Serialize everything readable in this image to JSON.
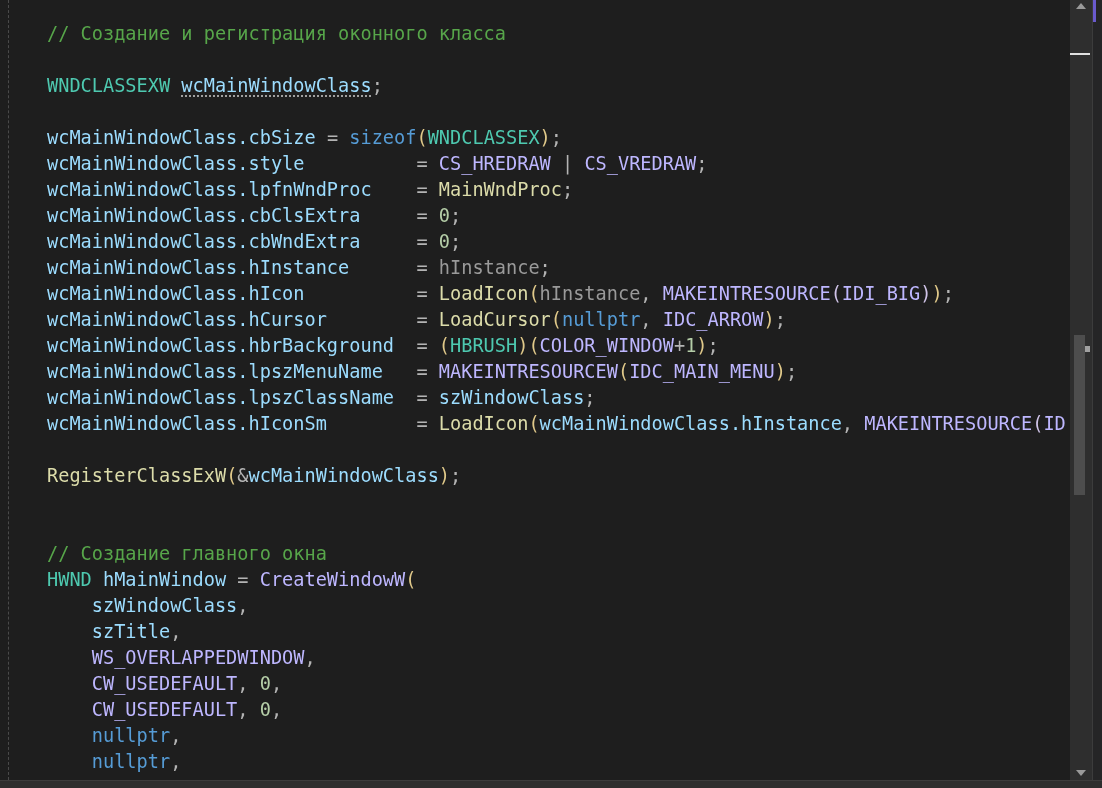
{
  "editor": {
    "lines": [
      {
        "kind": "code",
        "tokens": [
          {
            "kind": "comment",
            "text": "// Создание и регистрация оконного класса"
          }
        ]
      },
      {
        "kind": "blank"
      },
      {
        "kind": "code",
        "tokens": [
          {
            "kind": "type",
            "text": "WNDCLASSEXW"
          },
          {
            "kind": "var",
            "text": "wcMainWindowClass",
            "hinted": true,
            "gap": true
          },
          {
            "kind": "punct",
            "text": ";"
          }
        ]
      },
      {
        "kind": "blank"
      },
      {
        "kind": "code",
        "tokens": [
          {
            "kind": "var",
            "text": "wcMainWindowClass"
          },
          {
            "kind": "member",
            "text": ".cbSize"
          },
          {
            "kind": "punct",
            "text": " = "
          },
          {
            "kind": "keyword",
            "text": "sizeof"
          },
          {
            "kind": "bracket",
            "text": "("
          },
          {
            "kind": "type",
            "text": "WNDCLASSEX"
          },
          {
            "kind": "bracket",
            "text": ")"
          },
          {
            "kind": "punct",
            "text": ";"
          }
        ]
      },
      {
        "kind": "code",
        "tokens": [
          {
            "kind": "var",
            "text": "wcMainWindowClass"
          },
          {
            "kind": "member",
            "text": ".style"
          },
          {
            "kind": "punct",
            "text": "          = "
          },
          {
            "kind": "macro",
            "text": "CS_HREDRAW"
          },
          {
            "kind": "punct",
            "text": " | "
          },
          {
            "kind": "macro",
            "text": "CS_VREDRAW"
          },
          {
            "kind": "punct",
            "text": ";"
          }
        ]
      },
      {
        "kind": "code",
        "tokens": [
          {
            "kind": "var",
            "text": "wcMainWindowClass"
          },
          {
            "kind": "member",
            "text": ".lpfnWndProc"
          },
          {
            "kind": "punct",
            "text": "    = "
          },
          {
            "kind": "function",
            "text": "MainWndProc"
          },
          {
            "kind": "punct",
            "text": ";"
          }
        ]
      },
      {
        "kind": "code",
        "tokens": [
          {
            "kind": "var",
            "text": "wcMainWindowClass"
          },
          {
            "kind": "member",
            "text": ".cbClsExtra"
          },
          {
            "kind": "punct",
            "text": "     = "
          },
          {
            "kind": "number",
            "text": "0"
          },
          {
            "kind": "punct",
            "text": ";"
          }
        ]
      },
      {
        "kind": "code",
        "tokens": [
          {
            "kind": "var",
            "text": "wcMainWindowClass"
          },
          {
            "kind": "member",
            "text": ".cbWndExtra"
          },
          {
            "kind": "punct",
            "text": "     = "
          },
          {
            "kind": "number",
            "text": "0"
          },
          {
            "kind": "punct",
            "text": ";"
          }
        ]
      },
      {
        "kind": "code",
        "tokens": [
          {
            "kind": "var",
            "text": "wcMainWindowClass"
          },
          {
            "kind": "member",
            "text": ".hInstance"
          },
          {
            "kind": "punct",
            "text": "      = "
          },
          {
            "kind": "param",
            "text": "hInstance"
          },
          {
            "kind": "punct",
            "text": ";"
          }
        ]
      },
      {
        "kind": "code",
        "tokens": [
          {
            "kind": "var",
            "text": "wcMainWindowClass"
          },
          {
            "kind": "member",
            "text": ".hIcon"
          },
          {
            "kind": "punct",
            "text": "          = "
          },
          {
            "kind": "function",
            "text": "LoadIcon"
          },
          {
            "kind": "bracket",
            "text": "("
          },
          {
            "kind": "param",
            "text": "hInstance"
          },
          {
            "kind": "punct",
            "text": ", "
          },
          {
            "kind": "macro",
            "text": "MAKEINTRESOURCE"
          },
          {
            "kind": "bracket2",
            "text": "("
          },
          {
            "kind": "macro",
            "text": "IDI_BIG"
          },
          {
            "kind": "bracket2",
            "text": ")"
          },
          {
            "kind": "bracket",
            "text": ")"
          },
          {
            "kind": "punct",
            "text": ";"
          }
        ]
      },
      {
        "kind": "code",
        "tokens": [
          {
            "kind": "var",
            "text": "wcMainWindowClass"
          },
          {
            "kind": "member",
            "text": ".hCursor"
          },
          {
            "kind": "punct",
            "text": "        = "
          },
          {
            "kind": "function",
            "text": "LoadCursor"
          },
          {
            "kind": "bracket",
            "text": "("
          },
          {
            "kind": "keyword",
            "text": "nullptr"
          },
          {
            "kind": "punct",
            "text": ", "
          },
          {
            "kind": "macro",
            "text": "IDC_ARROW"
          },
          {
            "kind": "bracket",
            "text": ")"
          },
          {
            "kind": "punct",
            "text": ";"
          }
        ]
      },
      {
        "kind": "code",
        "tokens": [
          {
            "kind": "var",
            "text": "wcMainWindowClass"
          },
          {
            "kind": "member",
            "text": ".hbrBackground"
          },
          {
            "kind": "punct",
            "text": "  = "
          },
          {
            "kind": "bracket",
            "text": "("
          },
          {
            "kind": "type",
            "text": "HBRUSH"
          },
          {
            "kind": "bracket",
            "text": ")("
          },
          {
            "kind": "macro",
            "text": "COLOR_WINDOW"
          },
          {
            "kind": "punct",
            "text": "+"
          },
          {
            "kind": "number",
            "text": "1"
          },
          {
            "kind": "bracket",
            "text": ")"
          },
          {
            "kind": "punct",
            "text": ";"
          }
        ]
      },
      {
        "kind": "code",
        "tokens": [
          {
            "kind": "var",
            "text": "wcMainWindowClass"
          },
          {
            "kind": "member",
            "text": ".lpszMenuName"
          },
          {
            "kind": "punct",
            "text": "   = "
          },
          {
            "kind": "macro",
            "text": "MAKEINTRESOURCEW"
          },
          {
            "kind": "bracket",
            "text": "("
          },
          {
            "kind": "macro",
            "text": "IDC_MAIN_MENU"
          },
          {
            "kind": "bracket",
            "text": ")"
          },
          {
            "kind": "punct",
            "text": ";"
          }
        ]
      },
      {
        "kind": "code",
        "tokens": [
          {
            "kind": "var",
            "text": "wcMainWindowClass"
          },
          {
            "kind": "member",
            "text": ".lpszClassName"
          },
          {
            "kind": "punct",
            "text": "  = "
          },
          {
            "kind": "var",
            "text": "szWindowClass"
          },
          {
            "kind": "punct",
            "text": ";"
          }
        ]
      },
      {
        "kind": "code",
        "tokens": [
          {
            "kind": "var",
            "text": "wcMainWindowClass"
          },
          {
            "kind": "member",
            "text": ".hIconSm"
          },
          {
            "kind": "punct",
            "text": "        = "
          },
          {
            "kind": "function",
            "text": "LoadIcon"
          },
          {
            "kind": "bracket",
            "text": "("
          },
          {
            "kind": "var",
            "text": "wcMainWindowClass"
          },
          {
            "kind": "member",
            "text": ".hInstance"
          },
          {
            "kind": "punct",
            "text": ", "
          },
          {
            "kind": "macro",
            "text": "MAKEINTRESOURCE"
          },
          {
            "kind": "bracket2",
            "text": "("
          },
          {
            "kind": "macro",
            "text": "ID"
          }
        ]
      },
      {
        "kind": "blank"
      },
      {
        "kind": "code",
        "tokens": [
          {
            "kind": "function",
            "text": "RegisterClassExW"
          },
          {
            "kind": "bracket",
            "text": "("
          },
          {
            "kind": "punct",
            "text": "&"
          },
          {
            "kind": "var",
            "text": "wcMainWindowClass"
          },
          {
            "kind": "bracket",
            "text": ")"
          },
          {
            "kind": "punct",
            "text": ";"
          }
        ]
      },
      {
        "kind": "blank"
      },
      {
        "kind": "blank"
      },
      {
        "kind": "code",
        "tokens": [
          {
            "kind": "comment",
            "text": "// Создание главного окна"
          }
        ]
      },
      {
        "kind": "code",
        "tokens": [
          {
            "kind": "type",
            "text": "HWND"
          },
          {
            "kind": "var",
            "text": "hMainWindow",
            "gap": true
          },
          {
            "kind": "punct",
            "text": " = "
          },
          {
            "kind": "macro",
            "text": "CreateWindowW"
          },
          {
            "kind": "bracket",
            "text": "("
          }
        ]
      },
      {
        "kind": "code",
        "indented": true,
        "tokens": [
          {
            "kind": "var",
            "text": "szWindowClass"
          },
          {
            "kind": "punct",
            "text": ","
          }
        ]
      },
      {
        "kind": "code",
        "indented": true,
        "tokens": [
          {
            "kind": "var",
            "text": "szTitle"
          },
          {
            "kind": "punct",
            "text": ","
          }
        ]
      },
      {
        "kind": "code",
        "indented": true,
        "tokens": [
          {
            "kind": "macro",
            "text": "WS_OVERLAPPEDWINDOW"
          },
          {
            "kind": "punct",
            "text": ","
          }
        ]
      },
      {
        "kind": "code",
        "indented": true,
        "tokens": [
          {
            "kind": "macro",
            "text": "CW_USEDEFAULT"
          },
          {
            "kind": "punct",
            "text": ", "
          },
          {
            "kind": "number",
            "text": "0"
          },
          {
            "kind": "punct",
            "text": ","
          }
        ]
      },
      {
        "kind": "code",
        "indented": true,
        "tokens": [
          {
            "kind": "macro",
            "text": "CW_USEDEFAULT"
          },
          {
            "kind": "punct",
            "text": ", "
          },
          {
            "kind": "number",
            "text": "0"
          },
          {
            "kind": "punct",
            "text": ","
          }
        ]
      },
      {
        "kind": "code",
        "indented": true,
        "tokens": [
          {
            "kind": "keyword",
            "text": "nullptr"
          },
          {
            "kind": "punct",
            "text": ","
          }
        ]
      },
      {
        "kind": "code",
        "indented": true,
        "tokens": [
          {
            "kind": "keyword",
            "text": "nullptr"
          },
          {
            "kind": "punct",
            "text": ","
          }
        ]
      }
    ]
  }
}
